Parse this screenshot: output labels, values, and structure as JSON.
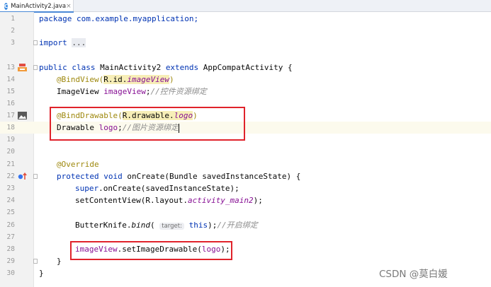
{
  "tab": {
    "icon": "C",
    "title": "MainActivity2.java",
    "close": "×"
  },
  "lines": {
    "n1": "1",
    "n2": "2",
    "n3": "3",
    "n13": "13",
    "n14": "14",
    "n15": "15",
    "n16": "16",
    "n17": "17",
    "n18": "18",
    "n19": "19",
    "n20": "20",
    "n21": "21",
    "n22": "22",
    "n23": "23",
    "n24": "24",
    "n25": "25",
    "n26": "26",
    "n27": "27",
    "n28": "28",
    "n29": "29",
    "n30": "30"
  },
  "code": {
    "l1": "package com.example.myapplication;",
    "l3_import": "import ",
    "l3_fold": "...",
    "l13_kw": "public class ",
    "l13_name": "MainActivity2 ",
    "l13_ext": "extends ",
    "l13_super": "AppCompatActivity {",
    "l14_ann": "@BindView(",
    "l14_r": "R.id.",
    "l14_field": "imageView",
    "l14_close": ")",
    "l15_type": "ImageView ",
    "l15_field": "imageView",
    "l15_semi": ";",
    "l15_cmt": "//控件资源绑定",
    "l17_ann": "@BindDrawable(",
    "l17_r": "R.drawable.",
    "l17_field": "logo",
    "l17_close": ")",
    "l18_type": "Drawable ",
    "l18_field": "logo",
    "l18_semi": ";",
    "l18_cmt": "//图片资源绑定",
    "l21_ann": "@Override",
    "l22_kw": "protected void ",
    "l22_rest": "onCreate(Bundle savedInstanceState) {",
    "l23_kw": "super",
    "l23_rest": ".onCreate(savedInstanceState);",
    "l24_call": "setContentView(R.layout.",
    "l24_field": "activity_main2",
    "l24_end": ");",
    "l26_call": "ButterKnife.",
    "l26_method": "bind",
    "l26_open": "( ",
    "l26_hint": "target:",
    "l26_this": " this",
    "l26_end": ");",
    "l26_cmt": "//开启绑定",
    "l28_field": "imageView",
    "l28_rest": ".setImageDrawable(",
    "l28_arg": "logo",
    "l28_end": ");",
    "l29": "}",
    "l30": "}"
  },
  "watermark": "CSDN @莫白媛",
  "colors": {
    "highlight_box": "#e0232b",
    "keyword": "#0033b3",
    "annotation": "#9e880d",
    "field": "#871094",
    "comment": "#8c8c8c"
  },
  "icons": [
    "java-class-icon",
    "close-icon",
    "fold-marker-icon",
    "class-run-icon",
    "drawable-preview-icon",
    "override-marker-icon"
  ]
}
